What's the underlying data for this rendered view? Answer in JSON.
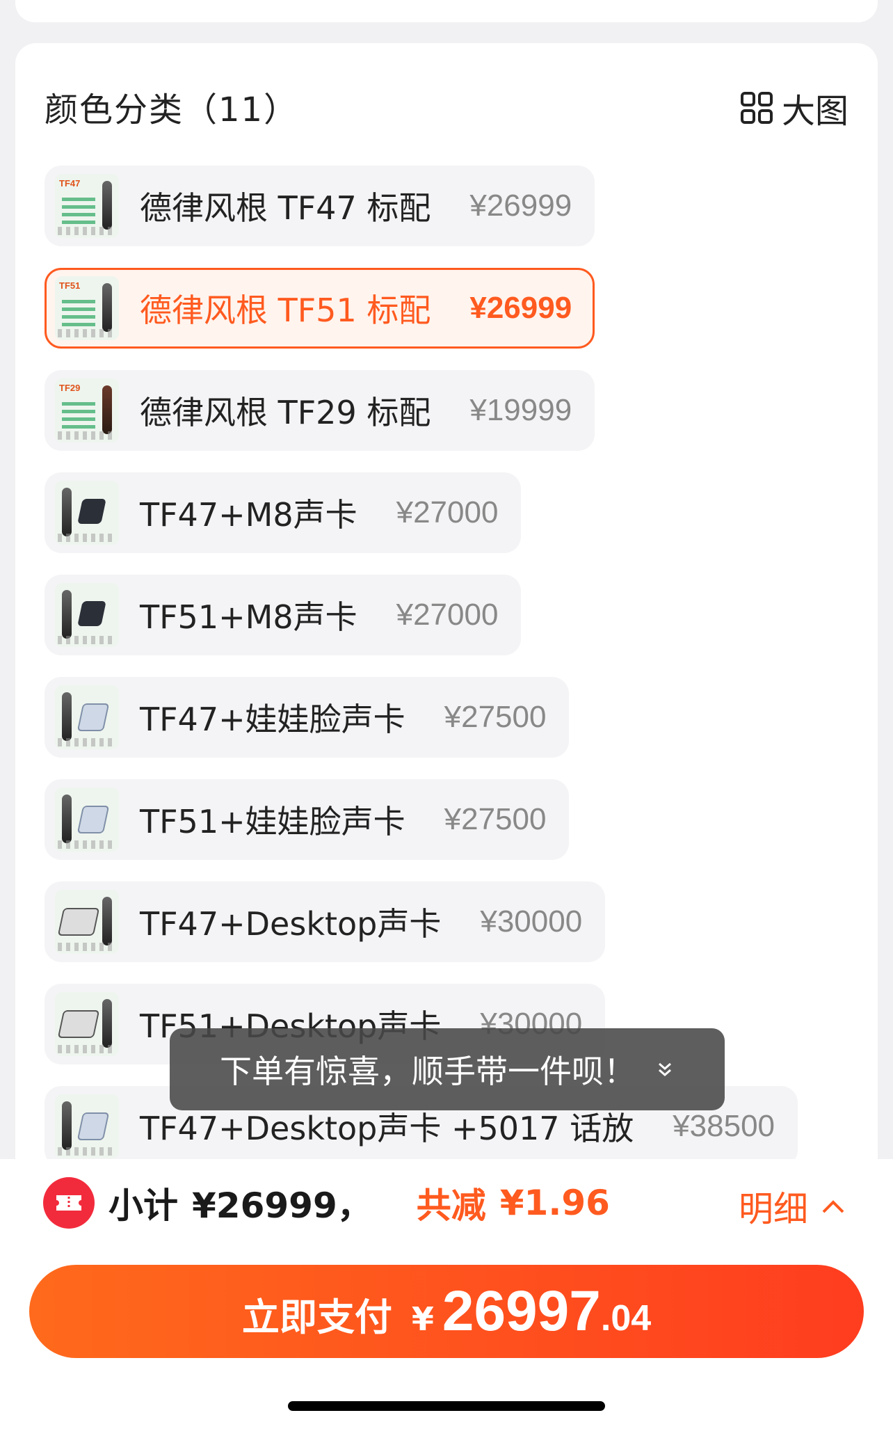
{
  "section": {
    "title": "颜色分类（11）",
    "view_toggle_label": "大图"
  },
  "variants": [
    {
      "name": "德律风根 TF47  标配",
      "price": "¥26999",
      "thumb_tag": "TF47",
      "selected": false
    },
    {
      "name": "德律风根 TF51  标配",
      "price": "¥26999",
      "thumb_tag": "TF51",
      "selected": true
    },
    {
      "name": "德律风根 TF29  标配",
      "price": "¥19999",
      "thumb_tag": "TF29",
      "selected": false
    },
    {
      "name": "TF47+M8声卡",
      "price": "¥27000",
      "thumb_tag": "",
      "selected": false
    },
    {
      "name": "TF51+M8声卡",
      "price": "¥27000",
      "thumb_tag": "",
      "selected": false
    },
    {
      "name": "TF47+娃娃脸声卡",
      "price": "¥27500",
      "thumb_tag": "",
      "selected": false
    },
    {
      "name": "TF51+娃娃脸声卡",
      "price": "¥27500",
      "thumb_tag": "",
      "selected": false
    },
    {
      "name": "TF47+Desktop声卡",
      "price": "¥30000",
      "thumb_tag": "",
      "selected": false
    },
    {
      "name": "TF51+Desktop声卡",
      "price": "¥30000",
      "thumb_tag": "",
      "selected": false
    },
    {
      "name": "TF47+Desktop声卡 +5017 话放",
      "price": "¥38500",
      "thumb_tag": "",
      "selected": false
    }
  ],
  "toast": {
    "text": "下单有惊喜，顺手带一件呗！"
  },
  "summary": {
    "subtotal_label": "小计",
    "subtotal_value": "¥26999，",
    "discount_label": "共减",
    "discount_value": "¥1.96",
    "details_label": "明细"
  },
  "pay": {
    "label": "立即支付",
    "currency": "¥",
    "amount_int": "26997",
    "amount_dec": ".04"
  },
  "colors": {
    "accent": "#ff5a1f",
    "coupon_red": "#f22b3c"
  }
}
